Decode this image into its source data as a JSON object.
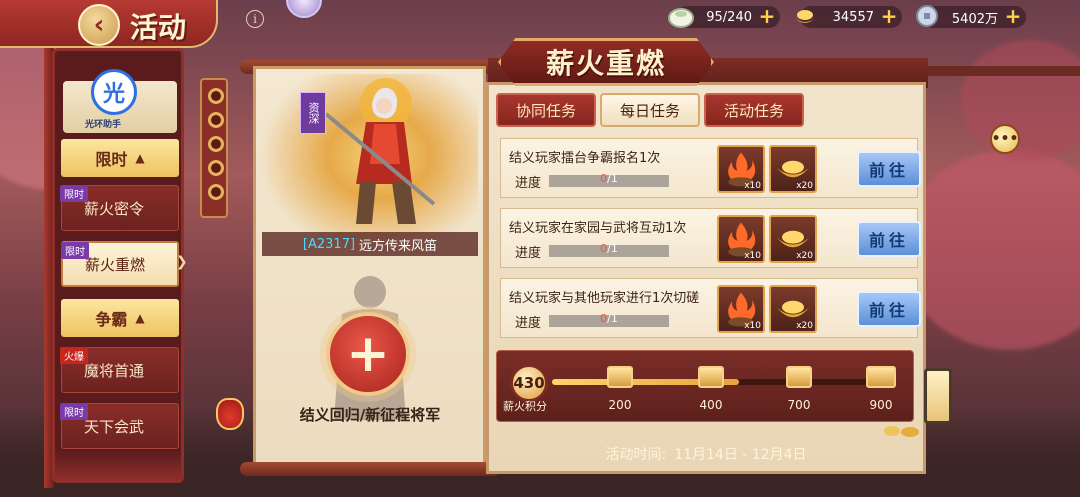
{
  "header": {
    "title": "活动",
    "back_label": "‹"
  },
  "resources": [
    {
      "icon": "stamina-bun-icon",
      "value": "95/240"
    },
    {
      "icon": "gold-ingot-icon",
      "value": "34557"
    },
    {
      "icon": "silver-coin-icon",
      "value": "5402万"
    }
  ],
  "sidebar": {
    "helper_logo": "光",
    "helper_text": "光环助手",
    "groups": [
      {
        "label": "限时",
        "chevron": "▲"
      },
      {
        "label": "争霸",
        "chevron": "▲"
      }
    ],
    "items": [
      {
        "tag": "限时",
        "label": "薪火密令"
      },
      {
        "tag": "限时",
        "label": "薪火重燃"
      },
      {
        "tag": "火爆",
        "label": "魔将首通"
      },
      {
        "tag": "限时",
        "label": "天下会武"
      }
    ],
    "active_arrow": "❯"
  },
  "hero": {
    "badge": "资深",
    "code": "[A2317]",
    "name": "远方传来风笛",
    "recruit_symbol": "+",
    "recruit_label": "结义回归/新征程将军"
  },
  "panel": {
    "title": "薪火重燃",
    "tabs": [
      "协同任务",
      "每日任务",
      "活动任务"
    ],
    "active_tab": 1,
    "tasks": [
      {
        "name": "结义玩家擂台争霸报名1次",
        "progress_label": "进度",
        "current": "0",
        "total": "/1",
        "progress": 0,
        "rewards": [
          {
            "icon": "fire-bowl-icon",
            "qty": "x10"
          },
          {
            "icon": "gold-ingot-icon",
            "qty": "x20"
          }
        ],
        "button": "前往"
      },
      {
        "name": "结义玩家在家园与武将互动1次",
        "progress_label": "进度",
        "current": "0",
        "total": "/1",
        "progress": 0,
        "rewards": [
          {
            "icon": "fire-bowl-icon",
            "qty": "x10"
          },
          {
            "icon": "gold-ingot-icon",
            "qty": "x20"
          }
        ],
        "button": "前往"
      },
      {
        "name": "结义玩家与其他玩家进行1次切磋",
        "progress_label": "进度",
        "current": "0",
        "total": "/1",
        "progress": 0,
        "rewards": [
          {
            "icon": "fire-bowl-icon",
            "qty": "x10"
          },
          {
            "icon": "gold-ingot-icon",
            "qty": "x20"
          }
        ],
        "button": "前往"
      }
    ],
    "points": {
      "value": "430",
      "label": "薪火积分",
      "milestones": [
        "200",
        "400",
        "700",
        "900"
      ],
      "fill_fraction": 0.55
    },
    "time": {
      "label": "活动时间:",
      "range": "11月14日 - 12月4日"
    }
  },
  "misc": {
    "chat_icon": "•••",
    "info_icon": "i"
  },
  "colors": {
    "accent_red": "#8f2b24",
    "gold": "#e6b35c",
    "go_button": "#5d8fd9",
    "progress_current": "#ff4d3a"
  }
}
